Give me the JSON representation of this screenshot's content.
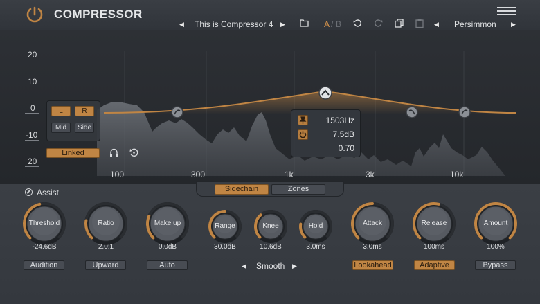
{
  "app": {
    "title": "COMPRESSOR",
    "menu_icon": "hamburger-icon",
    "accent": "#c08544"
  },
  "toolbar": {
    "preset_name": "This is Compressor 4",
    "ab_a": "A",
    "ab_sep": "/",
    "ab_b": "B",
    "preset_bank": "Persimmon"
  },
  "display": {
    "db_labels": [
      "20",
      "10",
      "0",
      "-10",
      "20"
    ],
    "freq_labels": [
      "100",
      "300",
      "1k",
      "3k",
      "10k"
    ],
    "channel_buttons": {
      "l": "L",
      "r": "R",
      "mid": "Mid",
      "side": "Side"
    },
    "linked_label": "Linked",
    "band": {
      "frequency": "1503Hz",
      "gain": "7.5dB",
      "q": "0.70"
    }
  },
  "tabs": {
    "sidechain": "Sidechain",
    "zones": "Zones"
  },
  "assist_label": "Assist",
  "knobs": [
    {
      "id": "threshold",
      "label": "Threshold",
      "value": "-24.6dB",
      "level": 0.45
    },
    {
      "id": "ratio",
      "label": "Ratio",
      "value": "2.0:1",
      "level": 0.2
    },
    {
      "id": "makeup",
      "label": "Make up",
      "value": "0.0dB",
      "level": 0.25
    },
    {
      "id": "range",
      "label": "Range",
      "value": "30.0dB",
      "level": 0.5
    },
    {
      "id": "knee",
      "label": "Knee",
      "value": "10.6dB",
      "level": 0.35
    },
    {
      "id": "hold",
      "label": "Hold",
      "value": "3.0ms",
      "level": 0.2
    },
    {
      "id": "attack",
      "label": "Attack",
      "value": "3.0ms",
      "level": 0.5
    },
    {
      "id": "release",
      "label": "Release",
      "value": "100ms",
      "level": 0.55
    },
    {
      "id": "amount",
      "label": "Amount",
      "value": "100%",
      "level": 1.0
    }
  ],
  "buttons": {
    "audition": "Audition",
    "upward": "Upward",
    "auto": "Auto",
    "smooth": "Smooth",
    "lookahead": "Lookahead",
    "adaptive": "Adaptive",
    "bypass": "Bypass"
  }
}
